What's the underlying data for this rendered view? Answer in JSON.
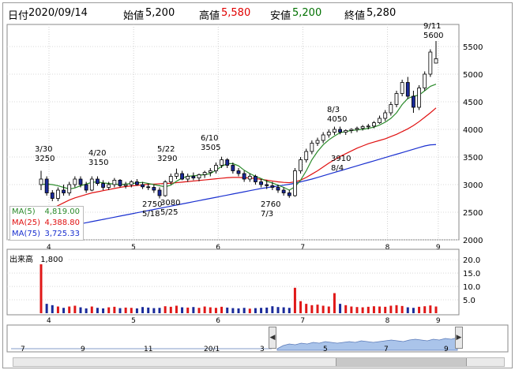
{
  "header": {
    "date_label": "日付",
    "date_value": "2020/09/14",
    "open_label": "始値",
    "open_value": "5,200",
    "high_label": "高値",
    "high_value": "5,580",
    "low_label": "安値",
    "low_value": "5,200",
    "close_label": "終値",
    "close_value": "5,280"
  },
  "colors": {
    "up": "#ffffff",
    "down": "#1a2a9a",
    "ma5": "#2a8a2a",
    "ma25": "#e01010",
    "ma75": "#1a30d0",
    "vol_up": "#e01818",
    "vol_down": "#1a2a9a",
    "open_green": "#007000",
    "high_red": "#e00000"
  },
  "legend": {
    "ma5_label": "MA(5)",
    "ma5_value": "4,819.00",
    "ma25_label": "MA(25)",
    "ma25_value": "4,388.80",
    "ma75_label": "MA(75)",
    "ma75_value": "3,725.33"
  },
  "volume": {
    "label": "出来高",
    "value": "1,800",
    "y_ticks": [
      "20.0",
      "15.0",
      "10.0",
      "5.0"
    ]
  },
  "navigator": {
    "x_labels": [
      "7",
      "9",
      "11",
      "20/1",
      "3",
      "5",
      "7",
      "9"
    ],
    "left_button_icon": "arrow-left-icon",
    "right_button_icon": "arrow-right-icon"
  },
  "annotations": [
    {
      "date": "3/30",
      "price": "3250"
    },
    {
      "date": "4/20",
      "price": "3150"
    },
    {
      "date": "5/22",
      "price": "3290"
    },
    {
      "date": "6/10",
      "price": "3505"
    },
    {
      "date": "5/25",
      "price": "3080"
    },
    {
      "date": "5/18",
      "price": "2750"
    },
    {
      "date": "7/3",
      "price": "2760"
    },
    {
      "date": "8/3",
      "price": "4050"
    },
    {
      "date": "8/4",
      "price": "3910"
    },
    {
      "date": "9/11",
      "price": "5600"
    }
  ],
  "chart_data": {
    "type": "candlestick",
    "ylim": [
      2000,
      5900
    ],
    "y_ticks": [
      "5500",
      "5000",
      "4500",
      "4000",
      "3500",
      "3000",
      "2500",
      "2000"
    ],
    "x_month_labels": [
      "4",
      "5",
      "6",
      "7",
      "8",
      "9"
    ],
    "candles": [
      [
        3000,
        3250,
        2900,
        3100
      ],
      [
        3100,
        3150,
        2800,
        2850
      ],
      [
        2850,
        2900,
        2700,
        2750
      ],
      [
        2750,
        2950,
        2700,
        2900
      ],
      [
        2900,
        3000,
        2800,
        2850
      ],
      [
        2850,
        3050,
        2800,
        3000
      ],
      [
        3000,
        3150,
        2950,
        3100
      ],
      [
        3100,
        3150,
        2950,
        3000
      ],
      [
        3000,
        3050,
        2850,
        2900
      ],
      [
        2900,
        3150,
        2880,
        3100
      ],
      [
        3100,
        3150,
        2980,
        3020
      ],
      [
        3020,
        3080,
        2900,
        2950
      ],
      [
        2950,
        3050,
        2900,
        3000
      ],
      [
        3000,
        3120,
        2950,
        3080
      ],
      [
        3080,
        3100,
        2950,
        2980
      ],
      [
        2980,
        3050,
        2930,
        3000
      ],
      [
        3000,
        3080,
        2950,
        3050
      ],
      [
        3050,
        3100,
        2980,
        3000
      ],
      [
        3000,
        3050,
        2920,
        2960
      ],
      [
        2960,
        3020,
        2900,
        2950
      ],
      [
        2950,
        3000,
        2850,
        2900
      ],
      [
        2900,
        2950,
        2750,
        2800
      ],
      [
        2800,
        3080,
        2780,
        3050
      ],
      [
        3050,
        3200,
        3000,
        3150
      ],
      [
        3150,
        3290,
        3100,
        3200
      ],
      [
        3200,
        3250,
        3080,
        3100
      ],
      [
        3100,
        3200,
        3050,
        3150
      ],
      [
        3150,
        3220,
        3080,
        3120
      ],
      [
        3120,
        3200,
        3060,
        3180
      ],
      [
        3180,
        3250,
        3120,
        3220
      ],
      [
        3220,
        3300,
        3150,
        3250
      ],
      [
        3250,
        3400,
        3200,
        3350
      ],
      [
        3350,
        3505,
        3300,
        3450
      ],
      [
        3450,
        3480,
        3300,
        3350
      ],
      [
        3350,
        3400,
        3200,
        3250
      ],
      [
        3250,
        3300,
        3150,
        3200
      ],
      [
        3200,
        3250,
        3050,
        3100
      ],
      [
        3100,
        3200,
        3050,
        3150
      ],
      [
        3150,
        3180,
        3000,
        3050
      ],
      [
        3050,
        3100,
        2950,
        3000
      ],
      [
        3000,
        3080,
        2920,
        2980
      ],
      [
        2980,
        3050,
        2900,
        2950
      ],
      [
        2950,
        3000,
        2850,
        2900
      ],
      [
        2900,
        2950,
        2800,
        2850
      ],
      [
        2850,
        2900,
        2760,
        2800
      ],
      [
        2800,
        3300,
        2780,
        3250
      ],
      [
        3250,
        3500,
        3200,
        3450
      ],
      [
        3450,
        3650,
        3400,
        3600
      ],
      [
        3600,
        3800,
        3550,
        3750
      ],
      [
        3750,
        3850,
        3700,
        3800
      ],
      [
        3800,
        3950,
        3750,
        3900
      ],
      [
        3900,
        4000,
        3850,
        3950
      ],
      [
        3950,
        4050,
        3900,
        4000
      ],
      [
        4000,
        4050,
        3910,
        3950
      ],
      [
        3950,
        4000,
        3900,
        3980
      ],
      [
        3980,
        4020,
        3930,
        4000
      ],
      [
        4000,
        4050,
        3950,
        4020
      ],
      [
        4020,
        4080,
        3980,
        4050
      ],
      [
        4050,
        4100,
        4000,
        4060
      ],
      [
        4060,
        4150,
        4020,
        4120
      ],
      [
        4120,
        4250,
        4100,
        4200
      ],
      [
        4200,
        4350,
        4150,
        4300
      ],
      [
        4300,
        4500,
        4250,
        4450
      ],
      [
        4450,
        4700,
        4400,
        4650
      ],
      [
        4650,
        4900,
        4600,
        4850
      ],
      [
        4850,
        4950,
        4550,
        4600
      ],
      [
        4600,
        4700,
        4300,
        4400
      ],
      [
        4400,
        4800,
        4350,
        4750
      ],
      [
        4750,
        5050,
        4700,
        5000
      ],
      [
        5000,
        5450,
        4950,
        5400
      ],
      [
        5200,
        5600,
        5200,
        5280
      ]
    ],
    "volumes": [
      20.5,
      3.5,
      3.0,
      2.5,
      2.0,
      2.5,
      2.8,
      2.2,
      1.8,
      2.5,
      2.0,
      1.8,
      2.2,
      2.4,
      1.9,
      2.1,
      2.0,
      1.8,
      2.3,
      2.1,
      1.9,
      2.0,
      2.6,
      2.4,
      2.8,
      2.2,
      2.1,
      2.3,
      2.0,
      2.5,
      2.2,
      2.0,
      2.4,
      2.1,
      1.9,
      1.8,
      2.0,
      1.7,
      1.9,
      2.0,
      2.1,
      2.6,
      2.3,
      2.2,
      2.0,
      9.5,
      4.5,
      3.5,
      3.0,
      3.2,
      2.8,
      2.5,
      7.5,
      3.5,
      3.0,
      2.5,
      2.3,
      2.2,
      2.4,
      2.6,
      2.5,
      2.4,
      2.8,
      3.0,
      2.7,
      2.2,
      2.0,
      2.4,
      2.6,
      2.9,
      2.5
    ],
    "ma5": [
      3000,
      3010,
      3000,
      2980,
      2950,
      2920,
      2940,
      2980,
      3010,
      3040,
      3050,
      3030,
      3020,
      3010,
      3000,
      3010,
      3020,
      3030,
      3040,
      3020,
      3000,
      2980,
      2960,
      2990,
      3060,
      3120,
      3150,
      3160,
      3170,
      3180,
      3200,
      3260,
      3330,
      3380,
      3380,
      3340,
      3260,
      3200,
      3150,
      3110,
      3060,
      3030,
      2990,
      2950,
      2900,
      2960,
      3080,
      3250,
      3450,
      3600,
      3720,
      3810,
      3880,
      3940,
      3960,
      3980,
      3990,
      4000,
      4020,
      4040,
      4080,
      4130,
      4200,
      4300,
      4450,
      4560,
      4600,
      4620,
      4700,
      4780,
      4819
    ],
    "ma25": [
      2450,
      2500,
      2560,
      2620,
      2670,
      2720,
      2760,
      2790,
      2820,
      2850,
      2870,
      2890,
      2910,
      2930,
      2950,
      2965,
      2975,
      2985,
      2995,
      3005,
      3010,
      3015,
      3020,
      3025,
      3035,
      3045,
      3055,
      3065,
      3075,
      3085,
      3095,
      3105,
      3115,
      3125,
      3130,
      3130,
      3125,
      3120,
      3110,
      3095,
      3080,
      3065,
      3050,
      3040,
      3035,
      3050,
      3080,
      3130,
      3190,
      3250,
      3320,
      3390,
      3450,
      3510,
      3560,
      3610,
      3660,
      3700,
      3740,
      3770,
      3800,
      3830,
      3870,
      3910,
      3960,
      4010,
      4070,
      4140,
      4220,
      4300,
      4388
    ],
    "ma75": [
      2150,
      2170,
      2190,
      2210,
      2230,
      2250,
      2270,
      2290,
      2310,
      2330,
      2350,
      2370,
      2390,
      2410,
      2430,
      2450,
      2470,
      2490,
      2510,
      2530,
      2550,
      2570,
      2590,
      2610,
      2630,
      2650,
      2670,
      2690,
      2710,
      2730,
      2750,
      2770,
      2790,
      2810,
      2830,
      2850,
      2870,
      2890,
      2910,
      2930,
      2945,
      2960,
      2975,
      2990,
      3005,
      3025,
      3050,
      3075,
      3100,
      3130,
      3160,
      3190,
      3220,
      3250,
      3280,
      3310,
      3340,
      3370,
      3400,
      3430,
      3460,
      3490,
      3520,
      3550,
      3580,
      3610,
      3640,
      3670,
      3700,
      3720,
      3725
    ]
  }
}
